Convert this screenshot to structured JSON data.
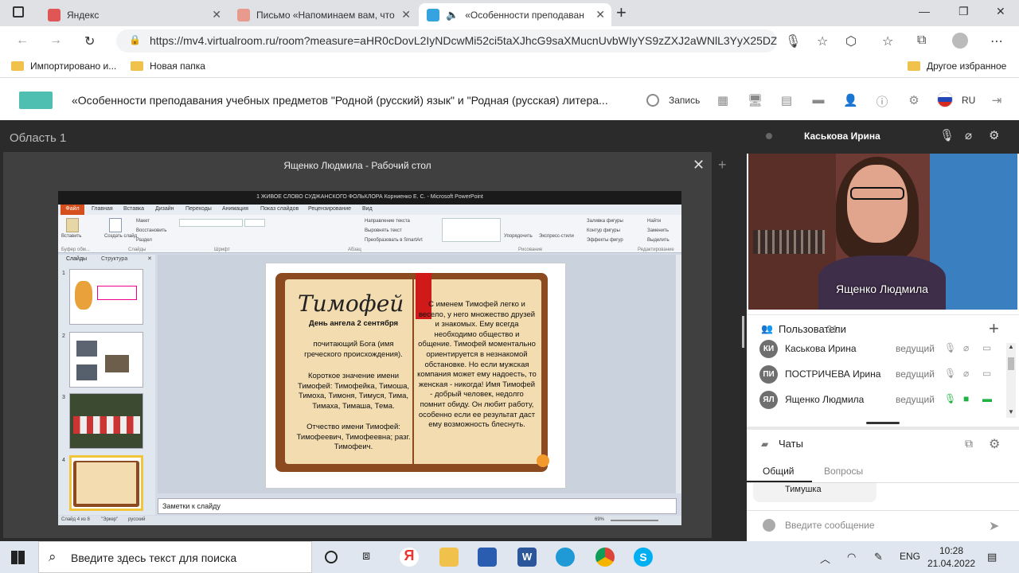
{
  "browser": {
    "tabs": [
      {
        "title": "Яндекс",
        "favicon_color": "#e05555"
      },
      {
        "title": "Письмо «Напоминаем вам, что",
        "favicon_color": "#e89a8c"
      },
      {
        "title": "«Особенности преподаван",
        "favicon_color": "#35a3e0"
      }
    ],
    "new_tab_label": "+",
    "url": "https://mv4.virtualroom.ru/room?measure=aHR0cDovL2IyNDcwMi52ci5taXJhcG9saXMucnUvbWIyYS9zZXJ2aWNlL3YyX25DZ...",
    "bookmarks": [
      "Импортировано и...",
      "Новая папка"
    ],
    "other_bookmarks": "Другое избранное"
  },
  "app": {
    "title": "«Особенности преподавания учебных предметов \"Родной (русский) язык\" и \"Родная (русская) литера...",
    "record_label": "Запись",
    "language": "RU",
    "area_label": "Область 1",
    "screenshare_title": "Ященко Людмила - Рабочий стол"
  },
  "ppt": {
    "title": "1 ЖИВОЕ СЛОВО СУДЖАНСКОГО ФОЛЬКЛОРА Корниенко Е. С. - Microsoft PowerPoint",
    "file_tab": "Файл",
    "menu": [
      "Главная",
      "Вставка",
      "Дизайн",
      "Переходы",
      "Анимация",
      "Показ слайдов",
      "Рецензирование",
      "Вид"
    ],
    "ribbon_groups": [
      "Буфер обм...",
      "Слайды",
      "Шрифт",
      "Абзац",
      "Рисование",
      "Редактирование"
    ],
    "ribbon_items": [
      "Вставить",
      "Создать слайд",
      "Макет",
      "Восстановить",
      "Раздел",
      "Направление текста",
      "Выровнять текст",
      "Преобразовать в SmartArt",
      "Упорядочить",
      "Экспресс-стили",
      "Заливка фигуры",
      "Контур фигуры",
      "Эффекты фигур",
      "Найти",
      "Заменить",
      "Выделить"
    ],
    "panel_tabs": [
      "Слайды",
      "Структура"
    ],
    "slide_numbers": [
      "1",
      "2",
      "3",
      "4"
    ],
    "notes_placeholder": "Заметки к слайду",
    "status": [
      "Слайд 4 из 8",
      "\"Эркер\"",
      "русский",
      "69%"
    ],
    "slide": {
      "name": "Тимофей",
      "left_text": [
        "День ангела 2 сентября",
        "почитающий Бога (имя греческого происхождения).",
        "Короткое значение имени Тимофей: Тимофейка, Тимоша, Тимоха, Тимоня, Тимуся, Тима, Тимаха, Тимаша, Тема.",
        "Отчество имени Тимофей: Тимофеевич, Тимофеевна; разг. Тимофеич."
      ],
      "right_text": "С именем Тимофей легко и весело, у него множество друзей и знакомых. Ему всегда необходимо общество и общение. Тимофей моментально ориентируется в незнакомой обстановке. Но если мужская компания может ему надоесть, то женская - никогда! Имя Тимофей - добрый человек, недолго помнит обиду. Он любит работу, особенно если ее результат даст ему возможность блеснуть."
    }
  },
  "speaker": {
    "name": "Каськова Ирина",
    "video_label": "Ященко Людмила"
  },
  "users": {
    "label": "Пользователи",
    "count": "31",
    "list": [
      {
        "initials": "КИ",
        "name": "Каськова Ирина",
        "role": "ведущий",
        "active": false
      },
      {
        "initials": "ПИ",
        "name": "ПОСТРИЧЕВА Ирина",
        "role": "ведущий",
        "active": false
      },
      {
        "initials": "ЯЛ",
        "name": "Ященко Людмила",
        "role": "ведущий",
        "active": true
      }
    ]
  },
  "chats": {
    "label": "Чаты",
    "tabs": [
      "Общий",
      "Вопросы"
    ],
    "last_message": "Тимушка",
    "input_placeholder": "Введите сообщение"
  },
  "taskbar": {
    "search_placeholder": "Введите здесь текст для поиска",
    "language": "ENG",
    "time": "10:28",
    "date": "21.04.2022"
  },
  "colors": {
    "accent_green": "#1fb141",
    "app_logo": "#4fbfb2",
    "ppt_file": "#d44f1d"
  }
}
